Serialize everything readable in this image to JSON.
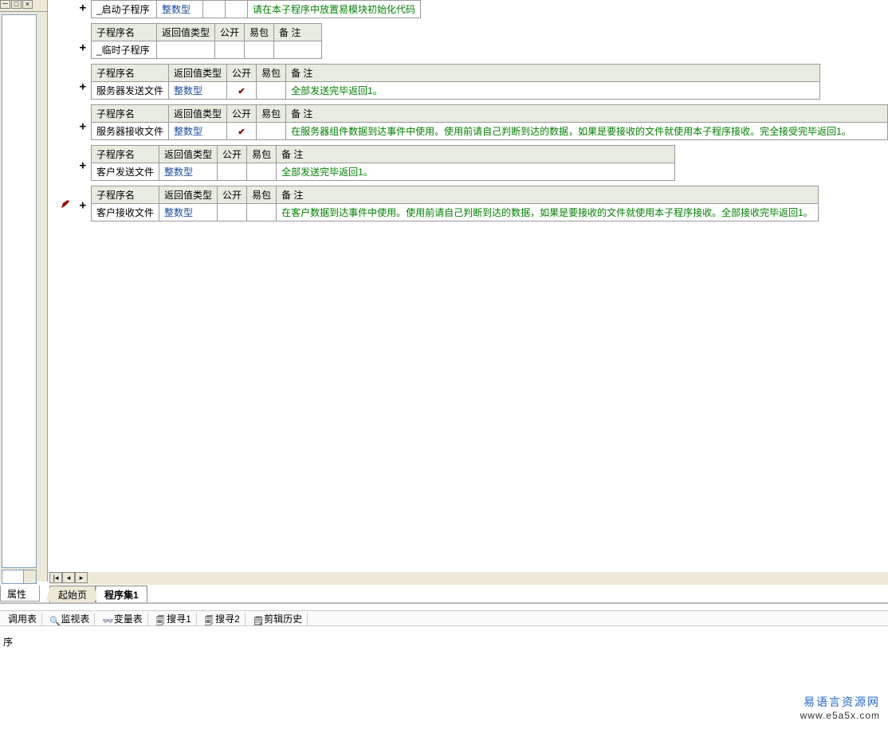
{
  "headers": {
    "name": "子程序名",
    "ret": "返回值类型",
    "pub": "公开",
    "pkg": "易包",
    "note": "备 注"
  },
  "type_int": "整数型",
  "subs": [
    {
      "name": "_启动子程序",
      "ret": "整数型",
      "pub": false,
      "pkg": false,
      "note": "请在本子程序中放置易模块初始化代码",
      "show_header": false,
      "note_w": 206
    },
    {
      "name": "_临时子程序",
      "ret": "",
      "pub": false,
      "pkg": false,
      "note": "",
      "show_header": true,
      "note_w": 60
    },
    {
      "name": "服务器发送文件",
      "ret": "整数型",
      "pub": true,
      "pkg": false,
      "note": "全部发送完毕返回1。",
      "show_header": true,
      "note_w": 670
    },
    {
      "name": "服务器接收文件",
      "ret": "整数型",
      "pub": true,
      "pkg": false,
      "note": "在服务器组件数据到达事件中使用。使用前请自己判断到达的数据，如果是要接收的文件就使用本子程序接收。完全接受完毕返回1。",
      "show_header": true,
      "note_w": 770
    },
    {
      "name": "客户发送文件",
      "ret": "整数型",
      "pub": false,
      "pkg": false,
      "note": "全部发送完毕返回1。",
      "show_header": true,
      "note_w": 500
    },
    {
      "name": "客户接收文件",
      "ret": "整数型",
      "pub": false,
      "pkg": false,
      "note": "在客户数据到达事件中使用。使用前请自己判断到达的数据，如果是要接收的文件就使用本子程序接收。全部接收完毕返回1。",
      "show_header": true,
      "note_w": 670,
      "editing": true
    }
  ],
  "prop_tab": "属性",
  "code_tabs": {
    "start": "起始页",
    "active": "程序集1"
  },
  "bottom_tabs": {
    "call": "调用表",
    "watch": "监视表",
    "var": "变量表",
    "s1": "搜寻1",
    "s2": "搜寻2",
    "clip": "剪辑历史"
  },
  "status": "序",
  "watermark": {
    "cn": "易语言资源网",
    "url": "www.e5a5x.com"
  }
}
